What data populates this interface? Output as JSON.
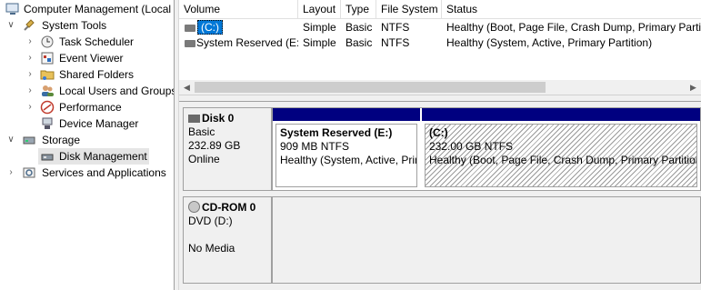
{
  "tree": {
    "root": "Computer Management (Local",
    "items": [
      {
        "label": "System Tools"
      },
      {
        "label": "Task Scheduler"
      },
      {
        "label": "Event Viewer"
      },
      {
        "label": "Shared Folders"
      },
      {
        "label": "Local Users and Groups"
      },
      {
        "label": "Performance"
      },
      {
        "label": "Device Manager"
      },
      {
        "label": "Storage"
      },
      {
        "label": "Disk Management"
      },
      {
        "label": "Services and Applications"
      }
    ]
  },
  "volume_list": {
    "columns": [
      "Volume",
      "Layout",
      "Type",
      "File System",
      "Status"
    ],
    "rows": [
      {
        "volume": "(C:)",
        "layout": "Simple",
        "type": "Basic",
        "fs": "NTFS",
        "status": "Healthy (Boot, Page File, Crash Dump, Primary Partition)"
      },
      {
        "volume": "System Reserved (E:)",
        "layout": "Simple",
        "type": "Basic",
        "fs": "NTFS",
        "status": "Healthy (System, Active, Primary Partition)"
      }
    ]
  },
  "disks": [
    {
      "name": "Disk 0",
      "type": "Basic",
      "size": "232.89 GB",
      "state": "Online",
      "partitions": [
        {
          "name": "System Reserved  (E:)",
          "size": "909 MB NTFS",
          "status": "Healthy (System, Active, Primary Partition)"
        },
        {
          "name": "(C:)",
          "size": "232.00 GB NTFS",
          "status": "Healthy (Boot, Page File, Crash Dump, Primary Partition)"
        }
      ]
    },
    {
      "name": "CD-ROM 0",
      "type": "DVD (D:)",
      "state": "No Media"
    }
  ],
  "colors": {
    "partition_bar": "#000080",
    "selection": "#0078d7"
  },
  "icons": [
    "computer-management-icon",
    "tools-icon",
    "clock-icon",
    "event-viewer-icon",
    "shared-folders-icon",
    "users-icon",
    "performance-icon",
    "device-manager-icon",
    "storage-icon",
    "disk-management-icon",
    "services-icon",
    "hdd-icon",
    "cdrom-icon"
  ]
}
